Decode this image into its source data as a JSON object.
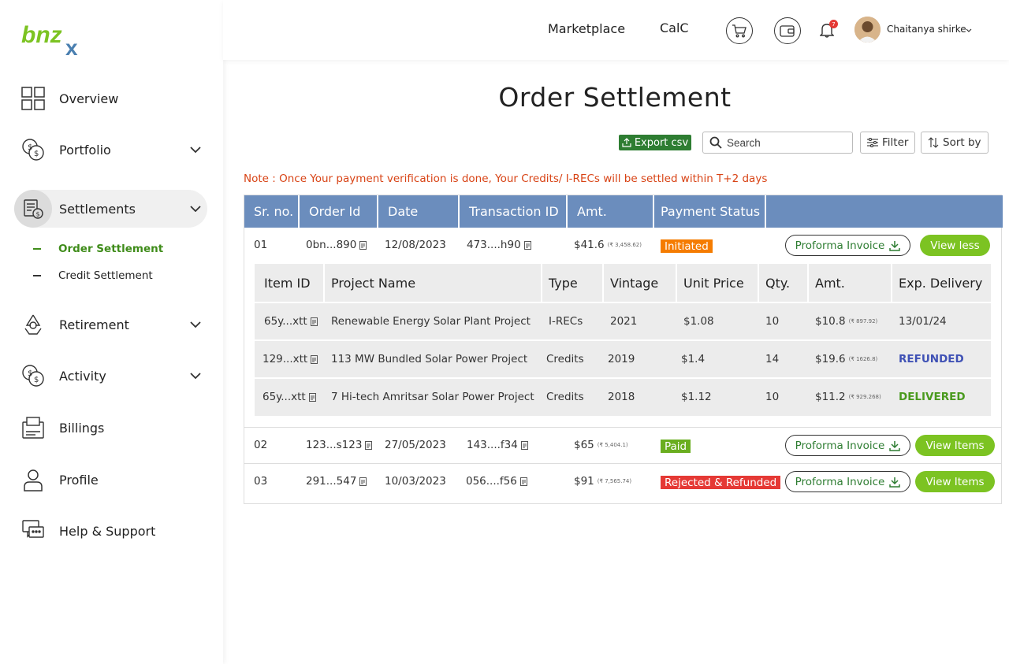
{
  "brand": {
    "logo_text": "bnzx"
  },
  "sidebar": {
    "items": [
      {
        "label": "Overview"
      },
      {
        "label": "Portfolio"
      },
      {
        "label": "Settlements"
      },
      {
        "label": "Retirement"
      },
      {
        "label": "Activity"
      },
      {
        "label": "Billings"
      },
      {
        "label": "Profile"
      },
      {
        "label": "Help & Support"
      }
    ],
    "sub_items": [
      {
        "label": "Order Settlement"
      },
      {
        "label": "Credit  Settlement"
      }
    ]
  },
  "header": {
    "marketplace": "Marketplace",
    "calc": "CalC",
    "notification_count": "7",
    "user_name": "Chaitanya shirke"
  },
  "page": {
    "title": "Order Settlement",
    "export_label": "Export csv",
    "search_placeholder": "Search",
    "filter_label": "Filter",
    "sort_label": "Sort by",
    "note": "Note : Once Your payment verification is done, Your Credits/ I-RECs will be settled within T+2 days"
  },
  "table": {
    "headers": [
      "Sr. no.",
      "Order Id",
      "Date",
      "Transaction ID",
      "Amt.",
      "Payment Status"
    ],
    "invoice_label": "Proforma Invoice",
    "rows": [
      {
        "sr": "01",
        "order_id": "0bn...890",
        "date": "12/08/2023",
        "txn": "473....h90",
        "amt": "$41.6",
        "amt_inr": "(₹ 3,458.62)",
        "status": "Initiated",
        "status_color": "#f57c00",
        "action": "View less"
      },
      {
        "sr": "02",
        "order_id": "123...s123",
        "date": "27/05/2023",
        "txn": "143....f34",
        "amt": "$65",
        "amt_inr": "(₹ 5,404.1)",
        "status": "Paid",
        "status_color": "#6aae1f",
        "action": "View Items"
      },
      {
        "sr": "03",
        "order_id": "291...547",
        "date": "10/03/2023",
        "txn": "056....f56",
        "amt": "$91",
        "amt_inr": "(₹ 7,565.74)",
        "status": "Rejected & Refunded",
        "status_color": "#e53935",
        "action": "View Items"
      }
    ]
  },
  "items_table": {
    "headers": [
      "Item ID",
      "Project Name",
      "Type",
      "Vintage",
      "Unit Price",
      "Qty.",
      "Amt.",
      "Exp. Delivery"
    ],
    "rows": [
      {
        "item_id": "65y...xtt",
        "project": "Renewable Energy Solar Plant Project",
        "type": "I-RECs",
        "vintage": "2021",
        "unit_price": "$1.08",
        "qty": "10",
        "amt": "$10.8",
        "amt_inr": "(₹ 897.92)",
        "delivery": "13/01/24",
        "delivery_color": "#333333"
      },
      {
        "item_id": "129...xtt",
        "project": "113 MW Bundled Solar Power Project",
        "type": "Credits",
        "vintage": "2019",
        "unit_price": "$1.4",
        "qty": "14",
        "amt": "$19.6",
        "amt_inr": "(₹ 1626.8)",
        "delivery": "REFUNDED",
        "delivery_color": "#3f51b5"
      },
      {
        "item_id": "65y...xtt",
        "project": "7 Hi-tech Amritsar Solar Power Project",
        "type": "Credits",
        "vintage": "2018",
        "unit_price": "$1.12",
        "qty": "10",
        "amt": "$11.2",
        "amt_inr": "(₹ 929.268)",
        "delivery": "DELIVERED",
        "delivery_color": "#4a9a1e"
      }
    ]
  },
  "colors": {
    "accent_green": "#7cc322",
    "header_blue": "#6b8dbd",
    "note_orange": "#d84315"
  }
}
